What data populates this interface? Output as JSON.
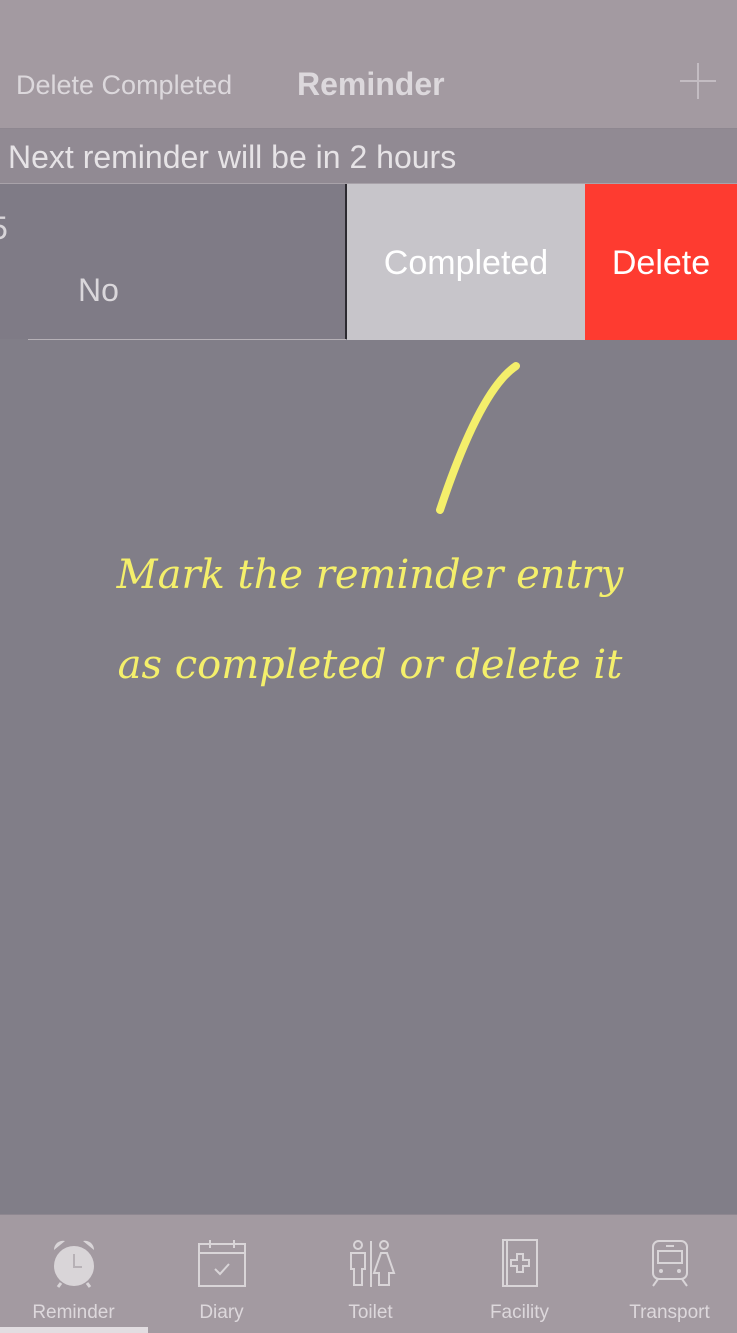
{
  "navbar": {
    "left_action": "Delete Completed",
    "title": "Reminder",
    "add_icon": "plus-icon"
  },
  "banner": {
    "text": "Next reminder will be in 2 hours"
  },
  "reminder_row": {
    "partial_text": "5",
    "value": "No",
    "completed_label": "Completed",
    "delete_label": "Delete"
  },
  "colors": {
    "completed_button": "#c7c5ca",
    "delete_button": "#fe3b30",
    "annotation": "#f4ef6b"
  },
  "annotation": {
    "line1": "Mark the reminder entry",
    "line2": "as completed or delete it"
  },
  "tabs": [
    {
      "label": "Reminder",
      "icon": "alarm-clock-icon",
      "selected": true
    },
    {
      "label": "Diary",
      "icon": "calendar-check-icon",
      "selected": false
    },
    {
      "label": "Toilet",
      "icon": "restroom-icon",
      "selected": false
    },
    {
      "label": "Facility",
      "icon": "first-aid-book-icon",
      "selected": false
    },
    {
      "label": "Transport",
      "icon": "train-icon",
      "selected": false
    }
  ]
}
